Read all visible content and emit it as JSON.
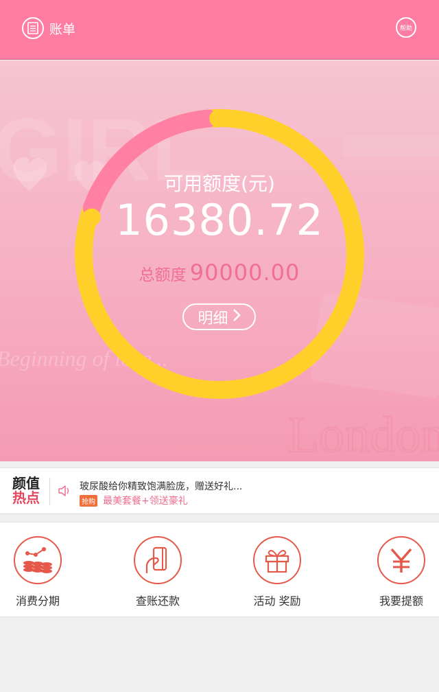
{
  "header": {
    "bill_label": "账单",
    "help_label": "帮助",
    "bg_color": "#ff7ca2"
  },
  "credit": {
    "available_label": "可用额度(元)",
    "available_amount": "16380.72",
    "total_label": "总额度",
    "total_amount": "90000.00",
    "detail_label": "明细",
    "ring_available_fraction": 0.182,
    "ring_colors": {
      "used": "#ffd02a",
      "available": "#ff7fa5"
    }
  },
  "hero_watermark": {
    "script_text": "Beginning of love...",
    "brand_text": "London",
    "bg_word": "GIRL"
  },
  "hot_news": {
    "logo_line1": "颜值",
    "logo_line2": "热点",
    "title": "玻尿酸给你精致饱满脸庞，赠送好礼...",
    "tag": "抢购",
    "subtitle": "最美套餐+领送豪礼"
  },
  "menu": {
    "items": [
      {
        "label": "消费分期",
        "icon": "coins-chart-icon"
      },
      {
        "label": "查账还款",
        "icon": "phone-hand-icon"
      },
      {
        "label": "活动 奖励",
        "icon": "gift-icon"
      },
      {
        "label": "我要提额",
        "icon": "yen-icon"
      }
    ],
    "accent_color": "#e5594a"
  }
}
